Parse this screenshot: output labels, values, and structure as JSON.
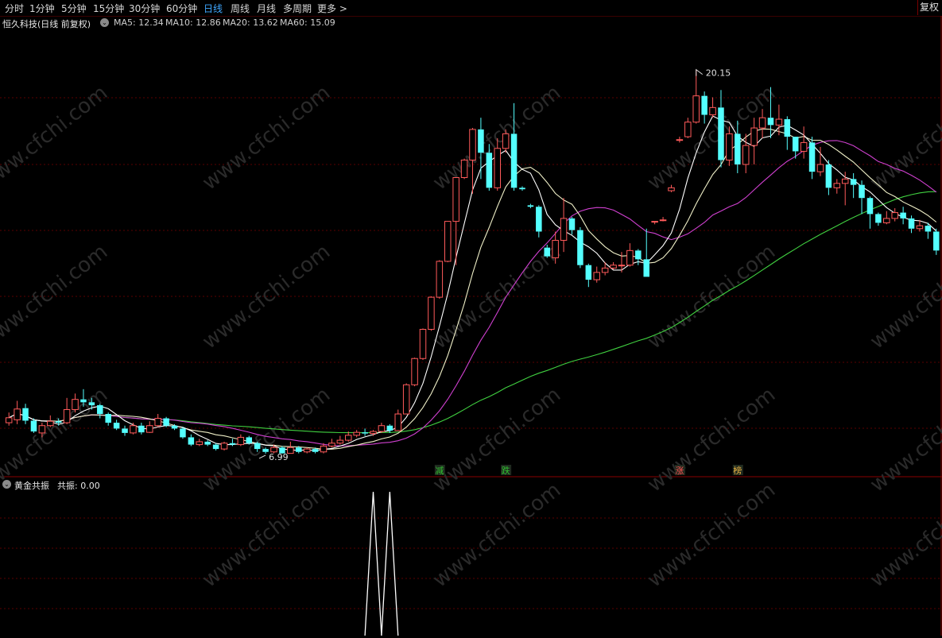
{
  "tabs": [
    {
      "label": "分时",
      "active": false
    },
    {
      "label": "1分钟",
      "active": false
    },
    {
      "label": "5分钟",
      "active": false
    },
    {
      "label": "15分钟",
      "active": false
    },
    {
      "label": "30分钟",
      "active": false
    },
    {
      "label": "60分钟",
      "active": false
    },
    {
      "label": "日线",
      "active": true
    },
    {
      "label": "周线",
      "active": false
    },
    {
      "label": "月线",
      "active": false
    },
    {
      "label": "多周期",
      "active": false
    },
    {
      "label": "更多 >",
      "active": false
    }
  ],
  "fuquan_button": "复权",
  "stock_title": "恒久科技(日线 前复权)",
  "ma_labels": [
    {
      "text": "MA5: 12.34",
      "color": "#e8e8e8"
    },
    {
      "text": "MA10: 12.86",
      "color": "#e8e8e8"
    },
    {
      "text": "MA20: 13.62",
      "color": "#d040d0"
    },
    {
      "text": "MA60: 15.09",
      "color": "#40d040"
    }
  ],
  "sub_indicator": {
    "name": "黄金共振",
    "value_text": "共振: 0.00"
  },
  "watermark": "www.cfchi.com",
  "colors": {
    "up": "#ff5a5a",
    "down": "#54ffff",
    "ma5": "#ffffff",
    "ma10": "#f0f0c8",
    "ma20": "#d040d0",
    "ma60": "#40d040",
    "grid": "#5a0000",
    "border": "#8a0000"
  },
  "chart_data": {
    "type": "candlestick",
    "price_range": [
      6.2,
      21.5
    ],
    "high_label": "20.15",
    "low_label": "6.99",
    "markers": [
      {
        "index": 52,
        "text": "减",
        "color": "#30c030"
      },
      {
        "index": 60,
        "text": "跌",
        "color": "#30c030"
      },
      {
        "index": 81,
        "text": "涨",
        "color": "#ff5050"
      },
      {
        "index": 88,
        "text": "榜",
        "color": "#e8b040"
      }
    ],
    "candles": [
      [
        8.05,
        8.22,
        8.4,
        7.95
      ],
      [
        8.15,
        8.52,
        8.8,
        8.0
      ],
      [
        8.55,
        8.12,
        8.7,
        8.0
      ],
      [
        8.12,
        7.75,
        8.2,
        7.7
      ],
      [
        7.7,
        7.95,
        8.05,
        7.55
      ],
      [
        7.95,
        8.1,
        8.3,
        7.9
      ],
      [
        8.1,
        8.05,
        8.2,
        7.95
      ],
      [
        8.05,
        8.5,
        8.9,
        8.0
      ],
      [
        8.5,
        8.85,
        9.05,
        8.4
      ],
      [
        8.85,
        8.75,
        9.2,
        8.6
      ],
      [
        8.75,
        8.65,
        8.9,
        8.5
      ],
      [
        8.65,
        8.35,
        8.7,
        8.2
      ],
      [
        8.35,
        8.05,
        8.4,
        7.95
      ],
      [
        8.05,
        7.85,
        8.15,
        7.8
      ],
      [
        7.85,
        7.7,
        7.95,
        7.6
      ],
      [
        7.7,
        7.95,
        8.05,
        7.65
      ],
      [
        7.95,
        7.72,
        8.05,
        7.65
      ],
      [
        7.72,
        7.95,
        8.1,
        7.7
      ],
      [
        7.95,
        8.2,
        8.35,
        7.9
      ],
      [
        8.2,
        7.95,
        8.25,
        7.9
      ],
      [
        7.95,
        7.85,
        8.0,
        7.8
      ],
      [
        7.85,
        7.55,
        7.9,
        7.5
      ],
      [
        7.55,
        7.3,
        7.65,
        7.25
      ],
      [
        7.3,
        7.4,
        7.5,
        7.25
      ],
      [
        7.4,
        7.3,
        7.45,
        7.25
      ],
      [
        7.3,
        7.15,
        7.35,
        7.1
      ],
      [
        7.15,
        7.35,
        7.4,
        7.1
      ],
      [
        7.35,
        7.3,
        7.5,
        7.25
      ],
      [
        7.3,
        7.55,
        7.65,
        7.25
      ],
      [
        7.55,
        7.35,
        7.6,
        7.3
      ],
      [
        7.35,
        7.15,
        7.4,
        7.05
      ],
      [
        7.15,
        7.05,
        7.2,
        6.99
      ],
      [
        7.05,
        7.2,
        7.3,
        7.0
      ],
      [
        7.2,
        7.0,
        7.25,
        6.99
      ],
      [
        7.0,
        7.2,
        7.4,
        6.99
      ],
      [
        7.2,
        7.05,
        7.25,
        7.0
      ],
      [
        7.05,
        7.15,
        7.2,
        7.0
      ],
      [
        7.15,
        7.05,
        7.2,
        7.0
      ],
      [
        7.05,
        7.25,
        7.35,
        7.0
      ],
      [
        7.25,
        7.35,
        7.5,
        7.2
      ],
      [
        7.35,
        7.45,
        7.6,
        7.3
      ],
      [
        7.45,
        7.62,
        7.75,
        7.4
      ],
      [
        7.62,
        7.72,
        7.8,
        7.55
      ],
      [
        7.72,
        7.68,
        7.85,
        7.6
      ],
      [
        7.68,
        7.75,
        7.8,
        7.6
      ],
      [
        7.75,
        7.95,
        8.05,
        7.7
      ],
      [
        7.95,
        7.78,
        8.0,
        7.7
      ],
      [
        7.78,
        8.35,
        8.5,
        7.78
      ],
      [
        8.35,
        9.35,
        9.4,
        8.35
      ],
      [
        9.35,
        10.25,
        10.28,
        9.3
      ],
      [
        10.25,
        11.25,
        11.28,
        10.2
      ],
      [
        11.25,
        12.35,
        12.38,
        11.2
      ],
      [
        12.35,
        13.58,
        13.62,
        12.3
      ],
      [
        13.58,
        14.95,
        14.95,
        13.55
      ],
      [
        14.95,
        16.45,
        16.45,
        13.45
      ],
      [
        16.45,
        17.05,
        17.1,
        16.4
      ],
      [
        17.05,
        18.1,
        18.15,
        15.9
      ],
      [
        18.1,
        17.3,
        18.5,
        16.4
      ],
      [
        17.3,
        16.1,
        17.6,
        16.0
      ],
      [
        16.1,
        17.45,
        17.8,
        16.0
      ],
      [
        17.45,
        17.95,
        18.1,
        17.3
      ],
      [
        17.95,
        16.1,
        19.0,
        16.0
      ],
      [
        16.1,
        16.05,
        16.15,
        16.0
      ],
      [
        15.5,
        15.45,
        15.55,
        15.4
      ],
      [
        15.45,
        14.6,
        15.5,
        14.4
      ],
      [
        14.05,
        13.75,
        14.15,
        13.7
      ],
      [
        13.7,
        14.3,
        14.6,
        13.5
      ],
      [
        14.3,
        15.05,
        15.75,
        13.9
      ],
      [
        15.05,
        14.65,
        15.1,
        14.5
      ],
      [
        14.65,
        13.45,
        14.75,
        13.35
      ],
      [
        13.45,
        12.95,
        13.5,
        12.7
      ],
      [
        12.95,
        13.2,
        13.4,
        12.85
      ],
      [
        13.2,
        13.35,
        13.55,
        13.1
      ],
      [
        13.35,
        13.45,
        13.55,
        13.3
      ],
      [
        13.45,
        13.45,
        13.9,
        13.2
      ],
      [
        13.45,
        13.95,
        14.2,
        13.4
      ],
      [
        13.95,
        13.65,
        14.0,
        13.45
      ],
      [
        13.65,
        13.05,
        14.7,
        13.05
      ],
      [
        14.95,
        14.95,
        14.95,
        14.85
      ],
      [
        15.0,
        15.0,
        15.1,
        14.95
      ],
      [
        16.0,
        16.1,
        16.2,
        15.95
      ],
      [
        17.75,
        17.75,
        17.85,
        17.65
      ],
      [
        17.85,
        18.35,
        18.5,
        17.8
      ],
      [
        18.35,
        19.25,
        20.15,
        18.3
      ],
      [
        19.25,
        18.6,
        19.4,
        18.3
      ],
      [
        18.6,
        18.85,
        19.2,
        18.5
      ],
      [
        18.85,
        17.05,
        19.45,
        16.8
      ],
      [
        17.05,
        17.95,
        18.2,
        16.85
      ],
      [
        17.95,
        16.9,
        18.4,
        16.6
      ],
      [
        16.9,
        17.55,
        17.95,
        16.6
      ],
      [
        17.55,
        18.15,
        18.5,
        16.9
      ],
      [
        18.15,
        18.5,
        18.8,
        17.8
      ],
      [
        18.5,
        18.25,
        19.55,
        17.8
      ],
      [
        18.25,
        18.45,
        18.95,
        17.9
      ],
      [
        18.45,
        17.85,
        18.55,
        17.4
      ],
      [
        17.85,
        17.35,
        17.85,
        17.1
      ],
      [
        17.35,
        17.65,
        18.2,
        17.1
      ],
      [
        17.65,
        16.65,
        17.85,
        16.4
      ],
      [
        16.65,
        16.9,
        17.5,
        16.5
      ],
      [
        16.9,
        16.1,
        17.05,
        15.85
      ],
      [
        16.1,
        16.25,
        16.4,
        15.9
      ],
      [
        16.25,
        16.4,
        16.65,
        15.5
      ],
      [
        16.4,
        16.2,
        16.6,
        15.75
      ],
      [
        16.2,
        15.75,
        16.35,
        15.2
      ],
      [
        15.75,
        15.2,
        15.8,
        14.7
      ],
      [
        15.2,
        14.9,
        15.25,
        14.8
      ],
      [
        14.9,
        15.05,
        15.3,
        14.85
      ],
      [
        15.05,
        15.25,
        15.4,
        14.95
      ],
      [
        15.25,
        15.05,
        15.45,
        14.85
      ],
      [
        15.05,
        14.7,
        15.15,
        14.55
      ],
      [
        14.7,
        14.8,
        15.0,
        14.6
      ],
      [
        14.8,
        14.6,
        14.9,
        14.35
      ],
      [
        14.6,
        13.95,
        14.7,
        13.8
      ]
    ],
    "resonance": {
      "range": [
        0,
        1
      ],
      "peaks": [
        {
          "start_index": 43,
          "peak_index": 44,
          "end_index": 45,
          "value": 1.0
        },
        {
          "start_index": 45,
          "peak_index": 46,
          "end_index": 47,
          "value": 1.0
        }
      ]
    }
  }
}
